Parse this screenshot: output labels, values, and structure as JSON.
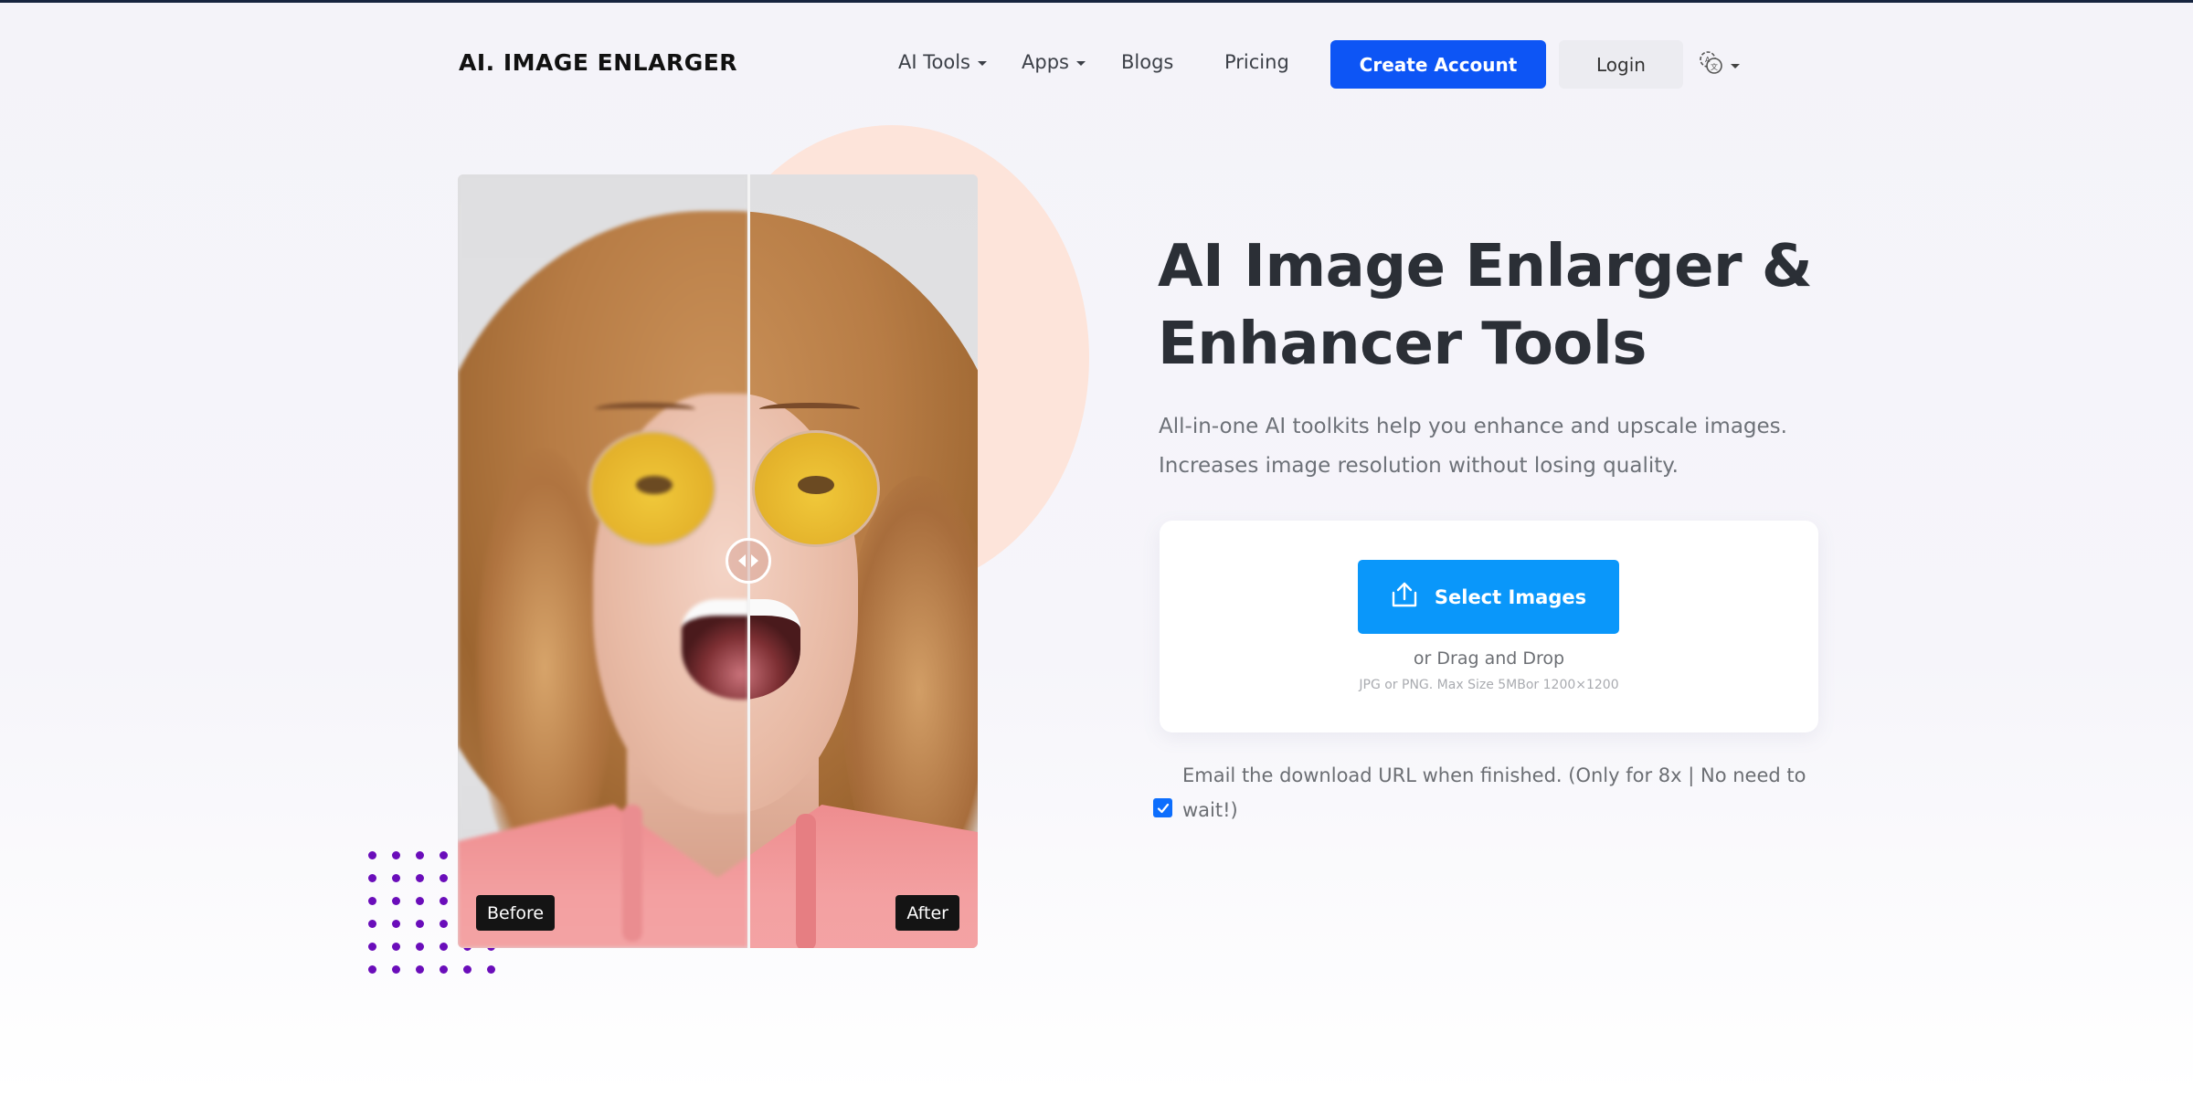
{
  "brand": {
    "logo_text": "AI. IMAGE ENLARGER"
  },
  "nav": {
    "items": [
      {
        "label": "AI Tools",
        "has_dropdown": true
      },
      {
        "label": "Apps",
        "has_dropdown": true
      },
      {
        "label": "Blogs",
        "has_dropdown": false
      },
      {
        "label": "Pricing",
        "has_dropdown": false
      }
    ],
    "create_account_label": "Create Account",
    "login_label": "Login",
    "language_icon": "translate-icon"
  },
  "compare": {
    "before_label": "Before",
    "after_label": "After",
    "slider_position": 0.56
  },
  "hero": {
    "title_line1": "AI Image Enlarger &",
    "title_line2": "Enhancer Tools",
    "subtitle_line1": "All-in-one AI toolkits help you enhance and upscale images.",
    "subtitle_line2": "Increases image resolution without losing quality."
  },
  "upload": {
    "button_label": "Select Images",
    "button_icon": "upload-icon",
    "drag_text": "or Drag and Drop",
    "limits_text": "JPG or PNG. Max Size 5MBor 1200×1200"
  },
  "email_option": {
    "checked": true,
    "label": "Email the download URL when finished. (Only for 8x | No need to wait!)"
  },
  "colors": {
    "primary_blue": "#0d55f5",
    "select_blue": "#0a97fa",
    "peach": "#fde4da",
    "dots_purple": "#6a0dba"
  }
}
